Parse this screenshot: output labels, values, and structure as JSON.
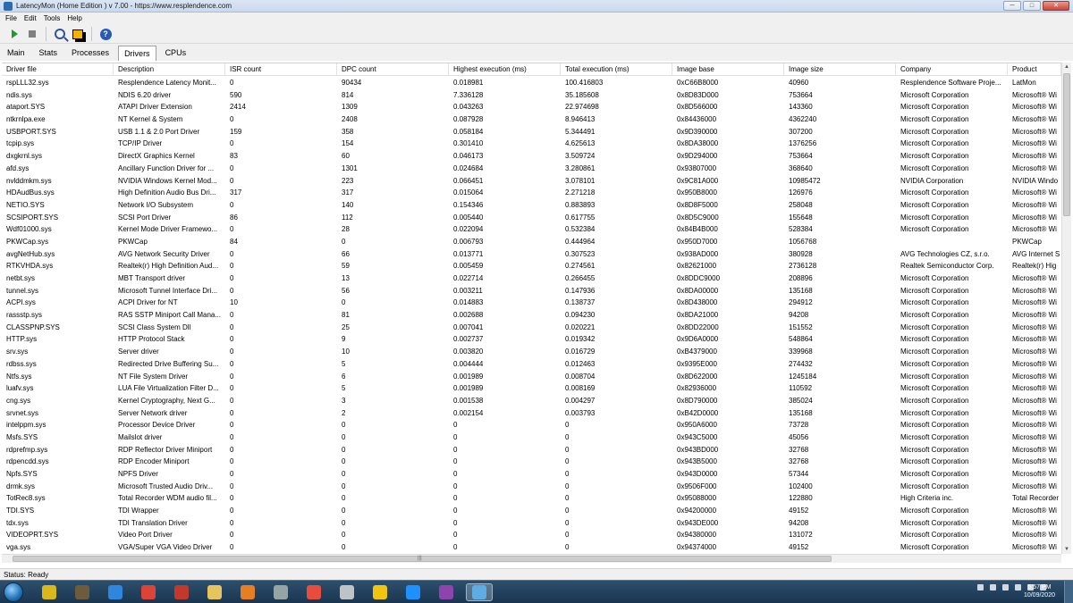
{
  "window": {
    "title": "LatencyMon  (Home Edition )  v 7.00 - https://www.resplendence.com",
    "min_label": "─",
    "max_label": "□",
    "close_label": "✕"
  },
  "menu": [
    "File",
    "Edit",
    "Tools",
    "Help"
  ],
  "tabs": [
    "Main",
    "Stats",
    "Processes",
    "Drivers",
    "CPUs"
  ],
  "active_tab": "Drivers",
  "columns": [
    "Driver file",
    "Description",
    "ISR count",
    "DPC count",
    "Highest execution (ms)",
    "Total execution (ms)",
    "Image base",
    "Image size",
    "Company",
    "Product"
  ],
  "rows": [
    [
      "rspLLL32.sys",
      "Resplendence Latency Monit...",
      "0",
      "90434",
      "0.018981",
      "100.416803",
      "0xC66B8000",
      "40960",
      "Resplendence Software Proje...",
      "LatMon"
    ],
    [
      "ndis.sys",
      "NDIS 6.20 driver",
      "590",
      "814",
      "7.336128",
      "35.185608",
      "0x8D83D000",
      "753664",
      "Microsoft Corporation",
      "Microsoft® Wi"
    ],
    [
      "ataport.SYS",
      "ATAPI Driver Extension",
      "2414",
      "1309",
      "0.043263",
      "22.974698",
      "0x8D566000",
      "143360",
      "Microsoft Corporation",
      "Microsoft® Wi"
    ],
    [
      "ntkrnlpa.exe",
      "NT Kernel & System",
      "0",
      "2408",
      "0.087928",
      "8.946413",
      "0x84436000",
      "4362240",
      "Microsoft Corporation",
      "Microsoft® Wi"
    ],
    [
      "USBPORT.SYS",
      "USB 1.1 & 2.0 Port Driver",
      "159",
      "358",
      "0.058184",
      "5.344491",
      "0x9D390000",
      "307200",
      "Microsoft Corporation",
      "Microsoft® Wi"
    ],
    [
      "tcpip.sys",
      "TCP/IP Driver",
      "0",
      "154",
      "0.301410",
      "4.625613",
      "0x8DA38000",
      "1376256",
      "Microsoft Corporation",
      "Microsoft® Wi"
    ],
    [
      "dxgkrnl.sys",
      "DirectX Graphics Kernel",
      "83",
      "60",
      "0.046173",
      "3.509724",
      "0x9D294000",
      "753664",
      "Microsoft Corporation",
      "Microsoft® Wi"
    ],
    [
      "afd.sys",
      "Ancillary Function Driver for ...",
      "0",
      "1301",
      "0.024684",
      "3.280861",
      "0x93807000",
      "368640",
      "Microsoft Corporation",
      "Microsoft® Wi"
    ],
    [
      "nvlddmkm.sys",
      "NVIDIA Windows Kernel Mod...",
      "0",
      "223",
      "0.066451",
      "3.078101",
      "0x9C81A000",
      "10985472",
      "NVIDIA Corporation",
      "NVIDIA Windo"
    ],
    [
      "HDAudBus.sys",
      "High Definition Audio Bus Dri...",
      "317",
      "317",
      "0.015064",
      "2.271218",
      "0x950B8000",
      "126976",
      "Microsoft Corporation",
      "Microsoft® Wi"
    ],
    [
      "NETIO.SYS",
      "Network I/O Subsystem",
      "0",
      "140",
      "0.154346",
      "0.883893",
      "0x8D8F5000",
      "258048",
      "Microsoft Corporation",
      "Microsoft® Wi"
    ],
    [
      "SCSIPORT.SYS",
      "SCSI Port Driver",
      "86",
      "112",
      "0.005440",
      "0.617755",
      "0x8D5C9000",
      "155648",
      "Microsoft Corporation",
      "Microsoft® Wi"
    ],
    [
      "Wdf01000.sys",
      "Kernel Mode Driver Framewo...",
      "0",
      "28",
      "0.022094",
      "0.532384",
      "0x84B4B000",
      "528384",
      "Microsoft Corporation",
      "Microsoft® Wi"
    ],
    [
      "PKWCap.sys",
      "PKWCap",
      "84",
      "0",
      "0.006793",
      "0.444964",
      "0x950D7000",
      "1056768",
      "",
      "PKWCap"
    ],
    [
      "avgNetHub.sys",
      "AVG Network Security Driver",
      "0",
      "66",
      "0.013771",
      "0.307523",
      "0x938AD000",
      "380928",
      "AVG Technologies CZ, s.r.o.",
      "AVG Internet S"
    ],
    [
      "RTKVHDA.sys",
      "Realtek(r) High Definition Aud...",
      "0",
      "59",
      "0.005459",
      "0.274561",
      "0x82621000",
      "2736128",
      "Realtek Semiconductor Corp.",
      "Realtek(r) Hig"
    ],
    [
      "netbt.sys",
      "MBT Transport driver",
      "0",
      "13",
      "0.022714",
      "0.266455",
      "0x8DDC9000",
      "208896",
      "Microsoft Corporation",
      "Microsoft® Wi"
    ],
    [
      "tunnel.sys",
      "Microsoft Tunnel Interface Dri...",
      "0",
      "56",
      "0.003211",
      "0.147936",
      "0x8DA00000",
      "135168",
      "Microsoft Corporation",
      "Microsoft® Wi"
    ],
    [
      "ACPI.sys",
      "ACPI Driver for NT",
      "10",
      "0",
      "0.014883",
      "0.138737",
      "0x8D438000",
      "294912",
      "Microsoft Corporation",
      "Microsoft® Wi"
    ],
    [
      "rassstp.sys",
      "RAS SSTP Miniport Call Mana...",
      "0",
      "81",
      "0.002688",
      "0.094230",
      "0x8DA21000",
      "94208",
      "Microsoft Corporation",
      "Microsoft® Wi"
    ],
    [
      "CLASSPNP.SYS",
      "SCSI Class System Dll",
      "0",
      "25",
      "0.007041",
      "0.020221",
      "0x8DD22000",
      "151552",
      "Microsoft Corporation",
      "Microsoft® Wi"
    ],
    [
      "HTTP.sys",
      "HTTP Protocol Stack",
      "0",
      "9",
      "0.002737",
      "0.019342",
      "0x9D6A0000",
      "548864",
      "Microsoft Corporation",
      "Microsoft® Wi"
    ],
    [
      "srv.sys",
      "Server driver",
      "0",
      "10",
      "0.003820",
      "0.016729",
      "0xB4379000",
      "339968",
      "Microsoft Corporation",
      "Microsoft® Wi"
    ],
    [
      "rdbss.sys",
      "Redirected Drive Buffering Su...",
      "0",
      "5",
      "0.004444",
      "0.012463",
      "0x9395E000",
      "274432",
      "Microsoft Corporation",
      "Microsoft® Wi"
    ],
    [
      "Ntfs.sys",
      "NT File System Driver",
      "0",
      "6",
      "0.001989",
      "0.008704",
      "0x8D622000",
      "1245184",
      "Microsoft Corporation",
      "Microsoft® Wi"
    ],
    [
      "luafv.sys",
      "LUA File Virtualization Filter D...",
      "0",
      "5",
      "0.001989",
      "0.008169",
      "0x82936000",
      "110592",
      "Microsoft Corporation",
      "Microsoft® Wi"
    ],
    [
      "cng.sys",
      "Kernel Cryptography, Next G...",
      "0",
      "3",
      "0.001538",
      "0.004297",
      "0x8D790000",
      "385024",
      "Microsoft Corporation",
      "Microsoft® Wi"
    ],
    [
      "srvnet.sys",
      "Server Network driver",
      "0",
      "2",
      "0.002154",
      "0.003793",
      "0xB42D0000",
      "135168",
      "Microsoft Corporation",
      "Microsoft® Wi"
    ],
    [
      "intelppm.sys",
      "Processor Device Driver",
      "0",
      "0",
      "0",
      "0",
      "0x950A6000",
      "73728",
      "Microsoft Corporation",
      "Microsoft® Wi"
    ],
    [
      "Msfs.SYS",
      "Mailslot driver",
      "0",
      "0",
      "0",
      "0",
      "0x943C5000",
      "45056",
      "Microsoft Corporation",
      "Microsoft® Wi"
    ],
    [
      "rdprefmp.sys",
      "RDP Reflector Driver Miniport",
      "0",
      "0",
      "0",
      "0",
      "0x943BD000",
      "32768",
      "Microsoft Corporation",
      "Microsoft® Wi"
    ],
    [
      "rdpencdd.sys",
      "RDP Encoder Miniport",
      "0",
      "0",
      "0",
      "0",
      "0x943B5000",
      "32768",
      "Microsoft Corporation",
      "Microsoft® Wi"
    ],
    [
      "Npfs.SYS",
      "NPFS Driver",
      "0",
      "0",
      "0",
      "0",
      "0x943D0000",
      "57344",
      "Microsoft Corporation",
      "Microsoft® Wi"
    ],
    [
      "drmk.sys",
      "Microsoft Trusted Audio Driv...",
      "0",
      "0",
      "0",
      "0",
      "0x9506F000",
      "102400",
      "Microsoft Corporation",
      "Microsoft® Wi"
    ],
    [
      "TotRec8.sys",
      "Total Recorder WDM audio fil...",
      "0",
      "0",
      "0",
      "0",
      "0x95088000",
      "122880",
      "High Criteria inc.",
      "Total Recorder"
    ],
    [
      "TDI.SYS",
      "TDI Wrapper",
      "0",
      "0",
      "0",
      "0",
      "0x94200000",
      "49152",
      "Microsoft Corporation",
      "Microsoft® Wi"
    ],
    [
      "tdx.sys",
      "TDI Translation Driver",
      "0",
      "0",
      "0",
      "0",
      "0x943DE000",
      "94208",
      "Microsoft Corporation",
      "Microsoft® Wi"
    ],
    [
      "VIDEOPRT.SYS",
      "Video Port Driver",
      "0",
      "0",
      "0",
      "0",
      "0x94380000",
      "131072",
      "Microsoft Corporation",
      "Microsoft® Wi"
    ],
    [
      "vga.sys",
      "VGA/Super VGA Video Driver",
      "0",
      "0",
      "0",
      "0",
      "0x94374000",
      "49152",
      "Microsoft Corporation",
      "Microsoft® Wi"
    ]
  ],
  "status": "Status: Ready",
  "taskbar": {
    "clock_time": "5:57 PM",
    "clock_date": "10/09/2020",
    "pinned": [
      {
        "name": "bell-icon",
        "color": "#d9b81c"
      },
      {
        "name": "book-icon",
        "color": "#6e5b3b"
      },
      {
        "name": "desktop-icon",
        "color": "#2e86de"
      },
      {
        "name": "chrome-icon",
        "color": "#db4437"
      },
      {
        "name": "x-app-icon",
        "color": "#c0392b"
      },
      {
        "name": "folder-icon",
        "color": "#e6c35c"
      },
      {
        "name": "media-player-icon",
        "color": "#e67e22"
      },
      {
        "name": "tools-icon",
        "color": "#95a5a6"
      },
      {
        "name": "lock-app-icon",
        "color": "#e74c3c"
      },
      {
        "name": "notes-icon",
        "color": "#bdc3c7"
      },
      {
        "name": "paint-icon",
        "color": "#f1c40f"
      },
      {
        "name": "edge-icon",
        "color": "#1e90ff"
      },
      {
        "name": "visual-studio-icon",
        "color": "#8e44ad"
      },
      {
        "name": "latencymon-taskbar-icon",
        "color": "#5dade2"
      }
    ]
  }
}
